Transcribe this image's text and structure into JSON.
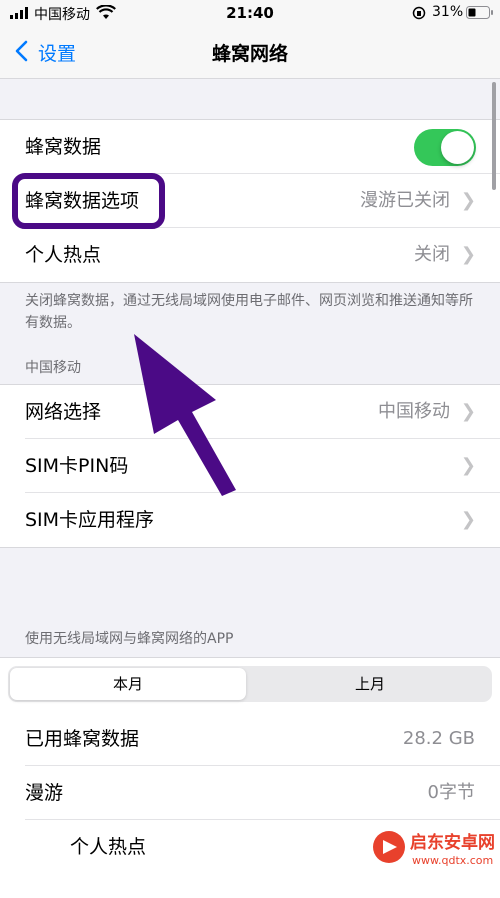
{
  "status_bar": {
    "carrier": "中国移动",
    "time": "21:40",
    "battery_percent": "31%"
  },
  "nav": {
    "back_label": "设置",
    "title": "蜂窝网络"
  },
  "cellular_group": {
    "cellular_data": {
      "label": "蜂窝数据",
      "toggle_on": true
    },
    "options": {
      "label": "蜂窝数据选项",
      "value": "漫游已关闭"
    },
    "hotspot": {
      "label": "个人热点",
      "value": "关闭"
    }
  },
  "cellular_footnote": "关闭蜂窝数据，通过无线局域网使用电子邮件、网页浏览和推送通知等所有数据。",
  "carrier_section": {
    "header": "中国移动",
    "network_selection": {
      "label": "网络选择",
      "value": "中国移动"
    },
    "sim_pin": {
      "label": "SIM卡PIN码"
    },
    "sim_apps": {
      "label": "SIM卡应用程序"
    }
  },
  "usage_section": {
    "header": "使用无线局域网与蜂窝网络的APP",
    "segments": [
      "本月",
      "上月"
    ],
    "selected_segment": 0,
    "used_data": {
      "label": "已用蜂窝数据",
      "value": "28.2 GB"
    },
    "roaming": {
      "label": "漫游",
      "value": "0字节"
    },
    "hotspot_usage": {
      "label": "个人热点"
    }
  },
  "watermark": {
    "text": "启东安卓网",
    "url": "www.qdtx.com"
  },
  "annotation_color": "#4b0a86",
  "accent_color": "#007aff",
  "toggle_color": "#34c759"
}
